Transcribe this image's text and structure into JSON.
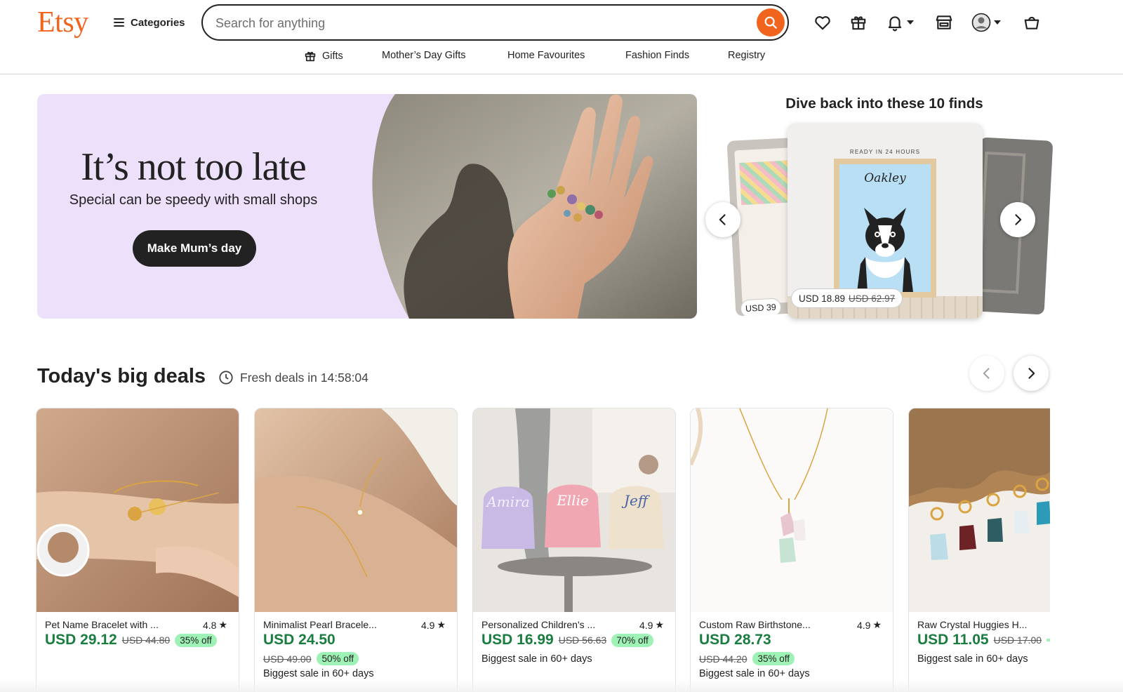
{
  "header": {
    "logo": "Etsy",
    "categories_label": "Categories",
    "search_placeholder": "Search for anything",
    "nav": [
      {
        "label": "Gifts",
        "icon": "gift-icon"
      },
      {
        "label": "Mother’s Day Gifts"
      },
      {
        "label": "Home Favourites"
      },
      {
        "label": "Fashion Finds"
      },
      {
        "label": "Registry"
      }
    ],
    "icons": [
      "heart-icon",
      "gift-icon",
      "bell-icon",
      "shop-icon",
      "avatar",
      "cart-icon"
    ]
  },
  "hero": {
    "title": "It’s not too late",
    "subtitle": "Special can be speedy with small shops",
    "button_label": "Make Mum’s day"
  },
  "recent": {
    "title": "Dive back into these 10 finds",
    "card_tag": "READY IN 24 HOURS",
    "card_name": "Oakley",
    "price": "USD 18.89",
    "old_price": "USD 62.97",
    "left_price": "USD 39"
  },
  "deals": {
    "title": "Today's big deals",
    "timer_label": "Fresh deals in 14:58:04",
    "items": [
      {
        "title": "Pet Name Bracelet with ...",
        "rating": "4.8",
        "price": "USD 29.12",
        "old_price": "USD 44.80",
        "discount": "35% off",
        "note": ""
      },
      {
        "title": "Minimalist Pearl Bracele...",
        "rating": "4.9",
        "price": "USD 24.50",
        "old_price": "USD 49.00",
        "discount": "50% off",
        "note": "Biggest sale in 60+ days"
      },
      {
        "title": "Personalized Children's ...",
        "rating": "4.9",
        "price": "USD 16.99",
        "old_price": "USD 56.63",
        "discount": "70% off",
        "note": "Biggest sale in 60+ days"
      },
      {
        "title": "Custom Raw Birthstone...",
        "rating": "4.9",
        "price": "USD 28.73",
        "old_price": "USD 44.20",
        "discount": "35% off",
        "note": "Biggest sale in 60+ days"
      },
      {
        "title": "Raw Crystal Huggies H...",
        "rating": "",
        "price": "USD 11.05",
        "old_price": "USD 17.00",
        "discount": "",
        "note": "Biggest sale in 60+ days"
      }
    ]
  },
  "colors": {
    "brand": "#f1641e",
    "hero_bg": "#ede0fb",
    "price_green": "#1a7d3f",
    "discount_bg": "#9ff2b5"
  }
}
